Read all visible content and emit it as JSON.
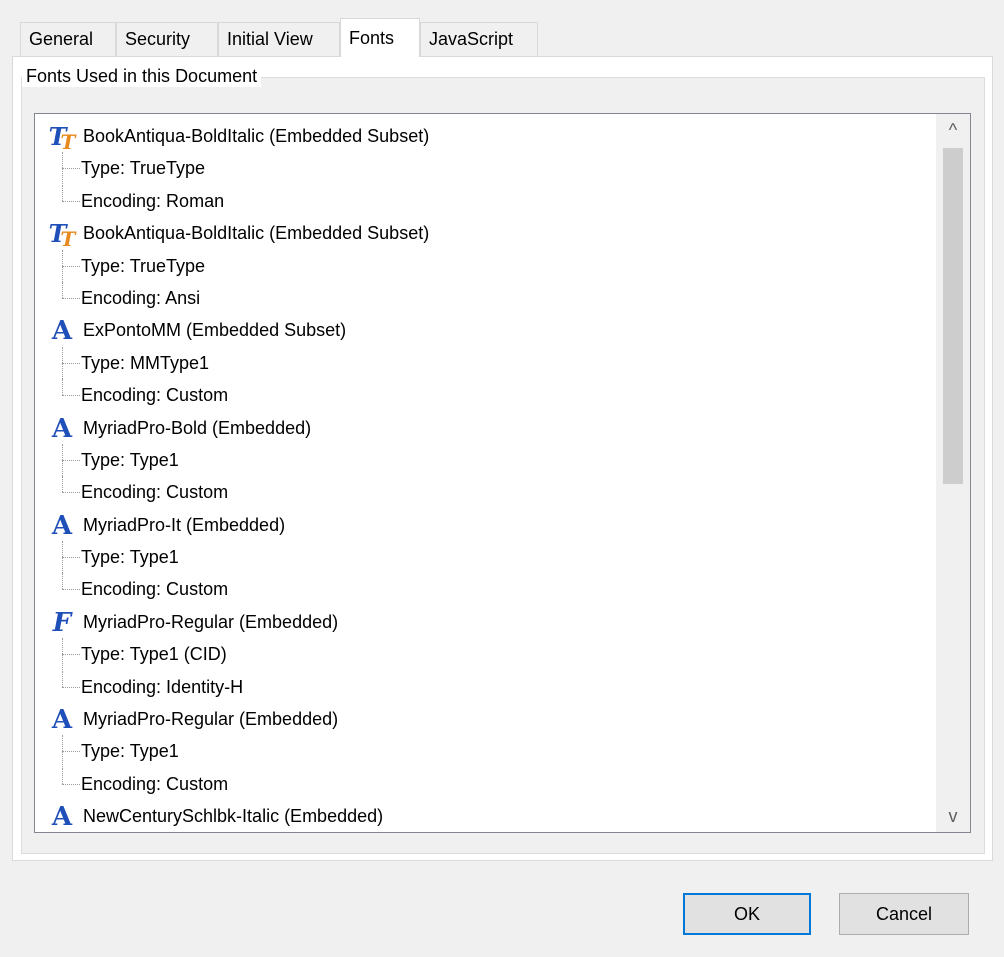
{
  "tabs": [
    {
      "label": "General",
      "active": false
    },
    {
      "label": "Security",
      "active": false
    },
    {
      "label": "Initial View",
      "active": false
    },
    {
      "label": "Fonts",
      "active": true
    },
    {
      "label": "JavaScript",
      "active": false
    }
  ],
  "group": {
    "label": "Fonts Used in this Document"
  },
  "fonts": [
    {
      "name": "BookAntiqua-BoldItalic (Embedded Subset)",
      "icon": "truetype-font-icon",
      "type": "Type: TrueType",
      "encoding": "Encoding: Roman"
    },
    {
      "name": "BookAntiqua-BoldItalic (Embedded Subset)",
      "icon": "truetype-font-icon",
      "type": "Type: TrueType",
      "encoding": "Encoding: Ansi"
    },
    {
      "name": "ExPontoMM (Embedded Subset)",
      "icon": "type1-font-icon",
      "type": "Type: MMType1",
      "encoding": "Encoding: Custom"
    },
    {
      "name": "MyriadPro-Bold (Embedded)",
      "icon": "type1-font-icon",
      "type": "Type: Type1",
      "encoding": "Encoding: Custom"
    },
    {
      "name": "MyriadPro-It (Embedded)",
      "icon": "type1-font-icon",
      "type": "Type: Type1",
      "encoding": "Encoding: Custom"
    },
    {
      "name": "MyriadPro-Regular (Embedded)",
      "icon": "cid-font-icon",
      "type": "Type: Type1 (CID)",
      "encoding": "Encoding: Identity-H"
    },
    {
      "name": "MyriadPro-Regular (Embedded)",
      "icon": "type1-font-icon",
      "type": "Type: Type1",
      "encoding": "Encoding: Custom"
    },
    {
      "name": "NewCenturySchlbk-Italic (Embedded)",
      "icon": "type1-font-icon"
    }
  ],
  "scrollbar": {
    "up_glyph": "^",
    "down_glyph": "v",
    "position": 0.0
  },
  "buttons": {
    "ok": "OK",
    "cancel": "Cancel"
  },
  "colors": {
    "accent": "#0078d7",
    "icon_blue": "#1f4fb8",
    "icon_orange": "#e8891d"
  }
}
